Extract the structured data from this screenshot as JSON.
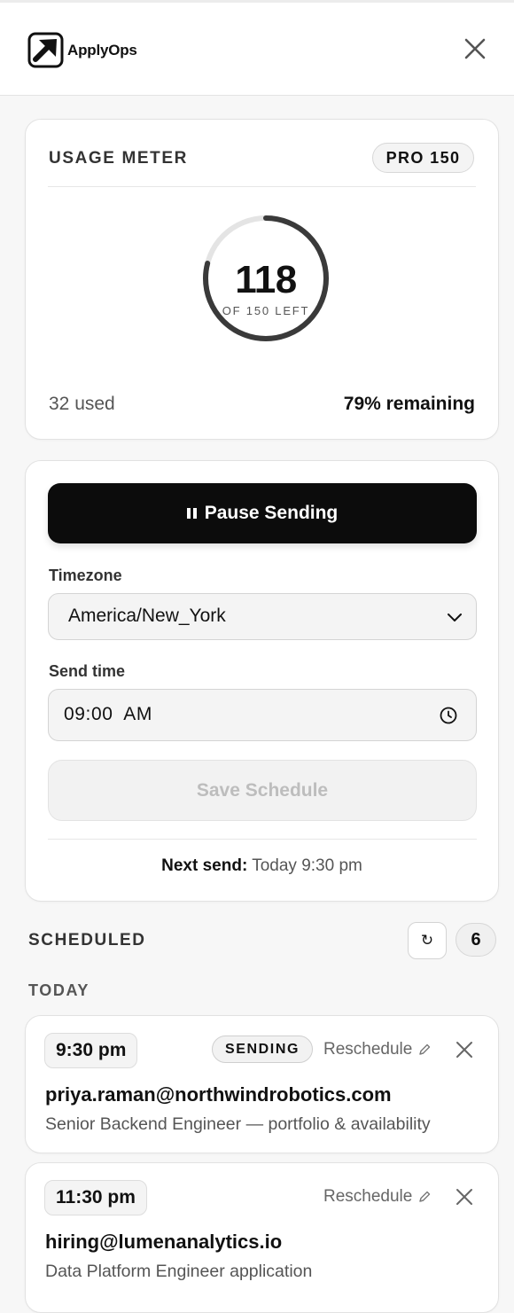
{
  "app": {
    "name": "ApplyOps"
  },
  "usage": {
    "title": "USAGE METER",
    "plan": "PRO 150",
    "remaining": "118",
    "remaining_caption": "OF 150 LEFT",
    "used_text": "32 used",
    "remaining_pct_text": "79% remaining",
    "used_fraction": 0.21
  },
  "controls": {
    "pause_label": "Pause Sending",
    "timezone_label": "Timezone",
    "timezone_value": "America/New_York",
    "send_time_label": "Send time",
    "send_time_value": "09:00  AM",
    "save_label": "Save Schedule",
    "next_send_label": "Next send:",
    "next_send_value": "Today 9:30 pm"
  },
  "scheduled": {
    "title": "SCHEDULED",
    "refresh_icon": "↻",
    "count": "6",
    "group_title": "TODAY",
    "reschedule_label": "Reschedule",
    "items": [
      {
        "time": "9:30 pm",
        "status": "SENDING",
        "email": "priya.raman@northwindrobotics.com",
        "subject": "Senior Backend Engineer — portfolio & availability"
      },
      {
        "time": "11:30 pm",
        "email": "hiring@lumenanalytics.io",
        "subject": "Data Platform Engineer application"
      }
    ]
  }
}
